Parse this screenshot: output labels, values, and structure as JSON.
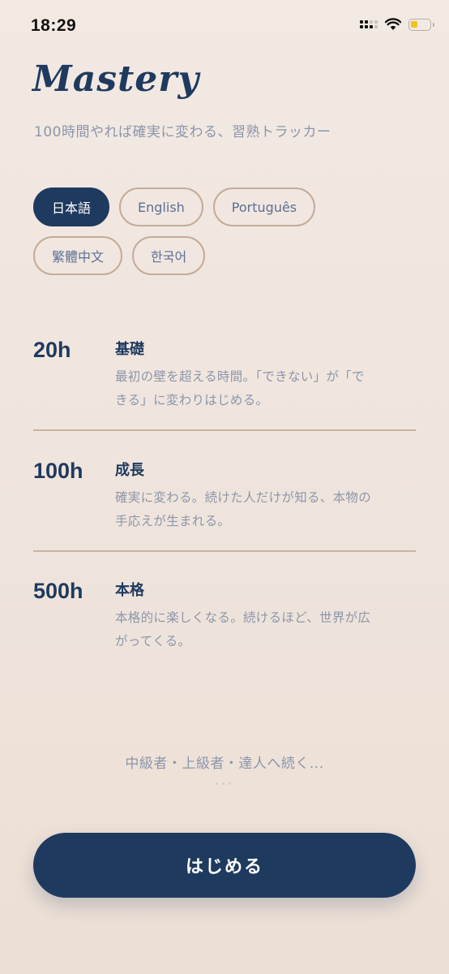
{
  "status_bar": {
    "time": "18:29"
  },
  "app": {
    "title": "Mastery",
    "subtitle": "100時間やれば確実に変わる、習熟トラッカー"
  },
  "languages": [
    {
      "label": "日本語",
      "selected": true
    },
    {
      "label": "English",
      "selected": false
    },
    {
      "label": "Português",
      "selected": false
    },
    {
      "label": "繁體中文",
      "selected": false
    },
    {
      "label": "한국어",
      "selected": false
    }
  ],
  "milestones": [
    {
      "hours": "20h",
      "title": "基礎",
      "desc_lines": [
        "最初の壁を超える時間。「できない」が「で",
        "きる」に変わりはじめる。"
      ]
    },
    {
      "hours": "100h",
      "title": "成長",
      "desc_lines": [
        "確実に変わる。続けた人だけが知る、本物の",
        "手応えが生まれる。"
      ]
    },
    {
      "hours": "500h",
      "title": "本格",
      "desc_lines": [
        "本格的に楽しくなる。続けるほど、世界が広",
        "がってくる。"
      ]
    }
  ],
  "more": {
    "text": "中級者・上級者・達人へ続く...",
    "dots": "···"
  },
  "start_button": {
    "label": "はじめる"
  },
  "colors": {
    "primary": "#1f3a5f",
    "muted_text": "#8b96aa",
    "pill_border": "#c4ab98",
    "background": "#f2e9e3"
  }
}
